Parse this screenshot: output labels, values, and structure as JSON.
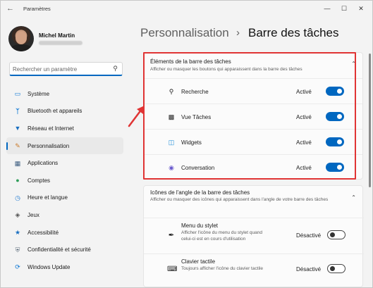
{
  "window": {
    "app_title": "Paramètres",
    "controls": [
      "—",
      "☐",
      "✕"
    ]
  },
  "user": {
    "name": "Michel Martin"
  },
  "search": {
    "placeholder": "Rechercher un paramètre"
  },
  "sidebar": {
    "items": [
      {
        "label": "Système",
        "icon": "monitor-icon",
        "active": false
      },
      {
        "label": "Bluetooth et appareils",
        "icon": "bluetooth-icon",
        "active": false
      },
      {
        "label": "Réseau et Internet",
        "icon": "wifi-icon",
        "active": false
      },
      {
        "label": "Personnalisation",
        "icon": "pencil-icon",
        "active": true
      },
      {
        "label": "Applications",
        "icon": "apps-icon",
        "active": false
      },
      {
        "label": "Comptes",
        "icon": "person-icon",
        "active": false
      },
      {
        "label": "Heure et langue",
        "icon": "globe-clock-icon",
        "active": false
      },
      {
        "label": "Jeux",
        "icon": "gamepad-icon",
        "active": false
      },
      {
        "label": "Accessibilité",
        "icon": "accessibility-icon",
        "active": false
      },
      {
        "label": "Confidentialité et sécurité",
        "icon": "shield-icon",
        "active": false
      },
      {
        "label": "Windows Update",
        "icon": "refresh-icon",
        "active": false
      }
    ]
  },
  "header": {
    "parent": "Personnalisation",
    "separator": "›",
    "current": "Barre des tâches"
  },
  "taskbar_items": {
    "title": "Éléments de la barre des tâches",
    "subtitle": "Afficher ou masquer les boutons qui apparaissent dans la barre des tâches",
    "rows": [
      {
        "label": "Recherche",
        "state": "Activé",
        "icon": "search-icon",
        "on": true
      },
      {
        "label": "Vue Tâches",
        "state": "Activé",
        "icon": "task-view-icon",
        "on": true
      },
      {
        "label": "Widgets",
        "state": "Activé",
        "icon": "widgets-icon",
        "on": true
      },
      {
        "label": "Conversation",
        "state": "Activé",
        "icon": "chat-icon",
        "on": true
      }
    ]
  },
  "corner_icons": {
    "title": "Icônes de l'angle de la barre des tâches",
    "subtitle": "Afficher ou masquer des icônes qui apparaissent dans l'angle de votre barre des tâches",
    "rows": [
      {
        "label": "Menu du stylet",
        "sub": "Afficher l'icône du menu du stylet quand celui-ci est en cours d'utilisation",
        "state": "Désactivé",
        "icon": "pen-icon",
        "on": false
      },
      {
        "label": "Clavier tactile",
        "sub": "Toujours afficher l'icône du clavier tactile",
        "state": "Désactivé",
        "icon": "keyboard-icon",
        "on": false
      }
    ]
  },
  "colors": {
    "accent": "#0067c0",
    "highlight": "#e03434"
  }
}
